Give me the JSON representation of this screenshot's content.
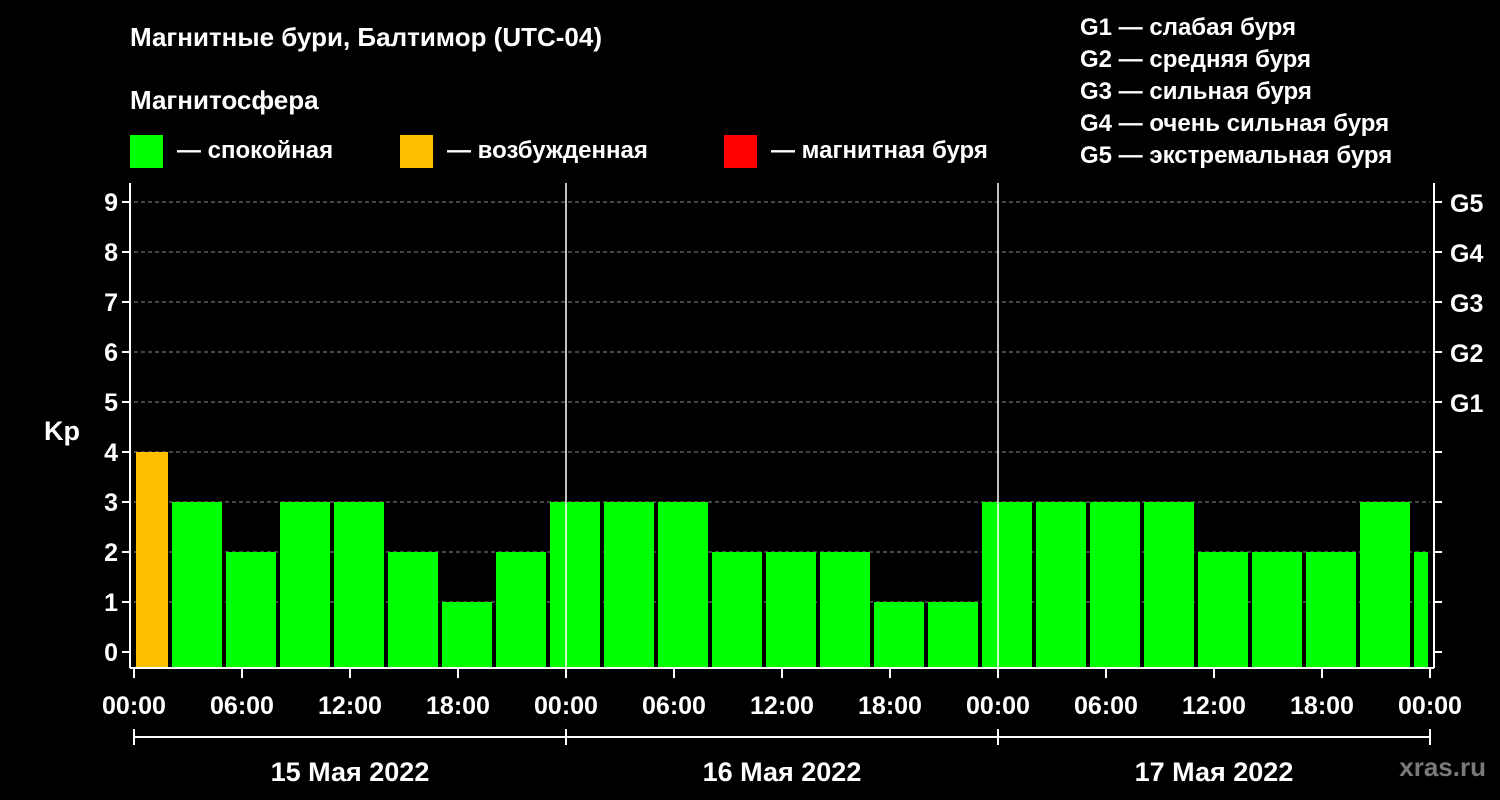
{
  "title": "Магнитные бури, Балтимор (UTC-04)",
  "magnetosphere_title": "Магнитосфера",
  "legend": [
    {
      "label": "— спокойная",
      "color": "#00ff00"
    },
    {
      "label": "— возбужденная",
      "color": "#ffbf00"
    },
    {
      "label": "— магнитная буря",
      "color": "#ff0000"
    }
  ],
  "g_legend": [
    "G1 — слабая буря",
    "G2 — средняя буря",
    "G3 — сильная буря",
    "G4 — очень сильная буря",
    "G5 — экстремальная буря"
  ],
  "watermark": "xras.ru",
  "chart_data": {
    "type": "bar",
    "ylabel": "Kp",
    "ylim": [
      0,
      9
    ],
    "yticks": [
      "0",
      "1",
      "2",
      "3",
      "4",
      "5",
      "6",
      "7",
      "8",
      "9"
    ],
    "right_ticks": [
      {
        "value": 5,
        "label": "G1"
      },
      {
        "value": 6,
        "label": "G2"
      },
      {
        "value": 7,
        "label": "G3"
      },
      {
        "value": 8,
        "label": "G4"
      },
      {
        "value": 9,
        "label": "G5"
      }
    ],
    "xlim_hours": [
      0,
      72
    ],
    "xtick_labels": [
      "00:00",
      "06:00",
      "12:00",
      "18:00",
      "00:00",
      "06:00",
      "12:00",
      "18:00",
      "00:00",
      "06:00",
      "12:00",
      "18:00",
      "00:00"
    ],
    "days": [
      "15 Мая 2022",
      "16 Мая 2022",
      "17 Мая 2022"
    ],
    "grid": "dashed horizontal",
    "bars": [
      {
        "start": 0,
        "end": 2,
        "value": 4,
        "state": "excited"
      },
      {
        "start": 2,
        "end": 5,
        "value": 3,
        "state": "calm"
      },
      {
        "start": 5,
        "end": 8,
        "value": 2,
        "state": "calm"
      },
      {
        "start": 8,
        "end": 11,
        "value": 3,
        "state": "calm"
      },
      {
        "start": 11,
        "end": 14,
        "value": 3,
        "state": "calm"
      },
      {
        "start": 14,
        "end": 17,
        "value": 2,
        "state": "calm"
      },
      {
        "start": 17,
        "end": 20,
        "value": 1,
        "state": "calm"
      },
      {
        "start": 20,
        "end": 23,
        "value": 2,
        "state": "calm"
      },
      {
        "start": 23,
        "end": 26,
        "value": 3,
        "state": "calm"
      },
      {
        "start": 26,
        "end": 29,
        "value": 3,
        "state": "calm"
      },
      {
        "start": 29,
        "end": 32,
        "value": 3,
        "state": "calm"
      },
      {
        "start": 32,
        "end": 35,
        "value": 2,
        "state": "calm"
      },
      {
        "start": 35,
        "end": 38,
        "value": 2,
        "state": "calm"
      },
      {
        "start": 38,
        "end": 41,
        "value": 2,
        "state": "calm"
      },
      {
        "start": 41,
        "end": 44,
        "value": 1,
        "state": "calm"
      },
      {
        "start": 44,
        "end": 47,
        "value": 1,
        "state": "calm"
      },
      {
        "start": 47,
        "end": 50,
        "value": 3,
        "state": "calm"
      },
      {
        "start": 50,
        "end": 53,
        "value": 3,
        "state": "calm"
      },
      {
        "start": 53,
        "end": 56,
        "value": 3,
        "state": "calm"
      },
      {
        "start": 56,
        "end": 59,
        "value": 3,
        "state": "calm"
      },
      {
        "start": 59,
        "end": 62,
        "value": 2,
        "state": "calm"
      },
      {
        "start": 62,
        "end": 65,
        "value": 2,
        "state": "calm"
      },
      {
        "start": 65,
        "end": 68,
        "value": 2,
        "state": "calm"
      },
      {
        "start": 68,
        "end": 71,
        "value": 3,
        "state": "calm"
      },
      {
        "start": 71,
        "end": 72,
        "value": 2,
        "state": "calm"
      }
    ],
    "state_colors": {
      "calm": "#00ff00",
      "excited": "#ffbf00",
      "storm": "#ff0000"
    }
  }
}
